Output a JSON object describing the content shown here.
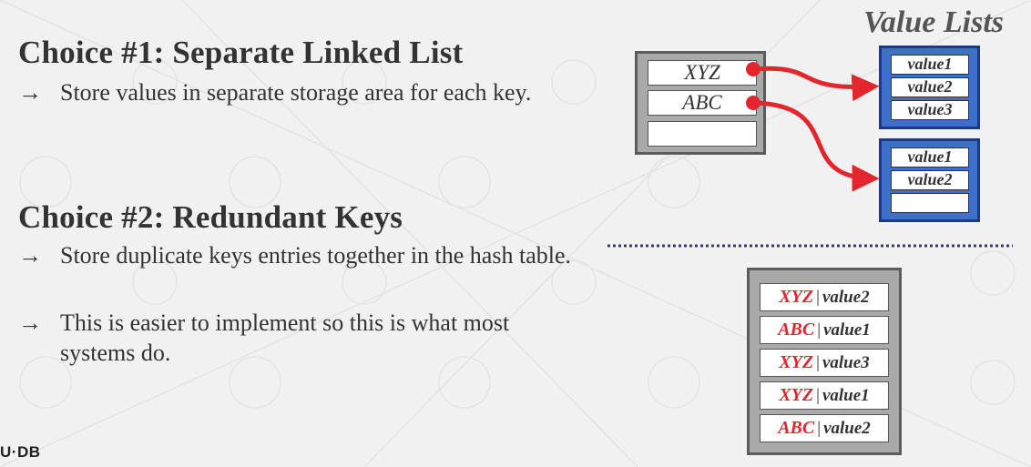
{
  "choice1": {
    "heading": "Choice #1: Separate Linked List",
    "bullets": [
      "Store values in separate storage area for each key."
    ]
  },
  "choice2": {
    "heading": "Choice #2: Redundant Keys",
    "bullets": [
      "Store duplicate keys entries together in the hash table.",
      "This is easier to implement so this is what most systems do."
    ]
  },
  "arrow_glyph": "→",
  "value_lists_title": "Value Lists",
  "hash_table": {
    "slots": [
      "XYZ",
      "ABC",
      ""
    ]
  },
  "value_lists": [
    {
      "values": [
        "value1",
        "value2",
        "value3"
      ]
    },
    {
      "values": [
        "value1",
        "value2",
        ""
      ]
    }
  ],
  "redundant_table": {
    "separator": "|",
    "entries": [
      {
        "key": "XYZ",
        "value": "value2"
      },
      {
        "key": "ABC",
        "value": "value1"
      },
      {
        "key": "XYZ",
        "value": "value3"
      },
      {
        "key": "XYZ",
        "value": "value1"
      },
      {
        "key": "ABC",
        "value": "value2"
      }
    ]
  },
  "logo": "U·DB",
  "colors": {
    "pointer": "#e3262e",
    "value_list_fill": "#3e6fc9",
    "value_list_border": "#1e3b80",
    "table_fill": "#a9a9a9",
    "key_text": "#e3262e"
  }
}
